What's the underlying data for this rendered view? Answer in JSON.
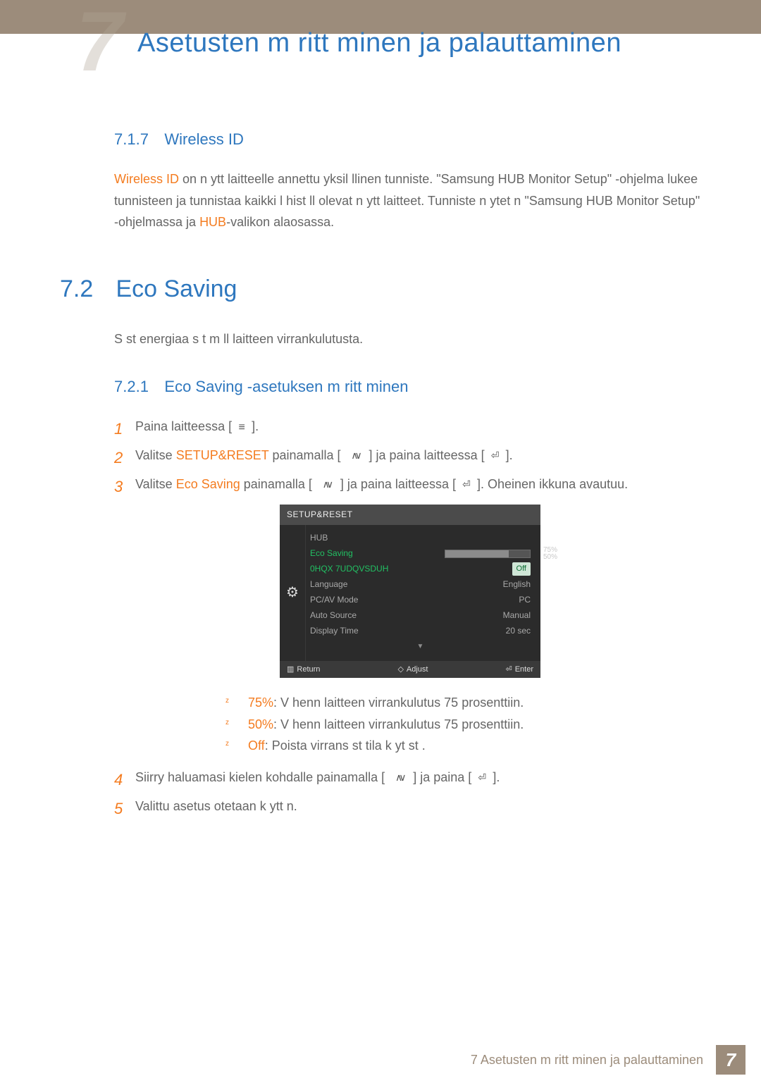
{
  "header": {
    "chapter_number_large": "7",
    "title": "Asetusten m  ritt minen ja palauttaminen"
  },
  "section_717": {
    "num": "7.1.7",
    "title": "Wireless ID",
    "lead_orange": "Wireless ID",
    "body_1": " on n ytt laitteelle annettu yksil llinen tunniste. \"Samsung HUB Monitor Setup\" -ohjelma lukee tunnisteen ja tunnistaa kaikki l hist ll  olevat n ytt laitteet. Tunniste n ytet  n \"Samsung HUB Monitor Setup\" -ohjelmassa ja ",
    "hub_orange": "HUB",
    "body_2": "-valikon alaosassa."
  },
  "section_72": {
    "num": "7.2",
    "title": "Eco Saving",
    "intro": "S  st  energiaa s  t m ll  laitteen virrankulutusta.",
    "sub_num": "7.2.1",
    "sub_title": "Eco Saving -asetuksen m  ritt minen",
    "steps": {
      "s1_a": "Paina laitteessa [",
      "s1_menu_icon": "≡",
      "s1_b": "  ].",
      "s2_a": "Valitse ",
      "s2_orange": "SETUP&RESET",
      "s2_b": " painamalla [",
      "s2_updown": "∧∨",
      "s2_c": "] ja paina laitteessa [",
      "s2_enter": "⏎",
      "s2_d": "].",
      "s3_a": "Valitse ",
      "s3_orange": "Eco Saving",
      "s3_b": " painamalla [",
      "s3_updown": "∧∨",
      "s3_c": "] ja paina laitteessa [",
      "s3_enter": "⏎",
      "s3_d": "]. Oheinen ikkuna avautuu.",
      "s4_a": "Siirry haluamasi kielen kohdalle painamalla [",
      "s4_updown": "∧∨",
      "s4_b": "  ] ja paina [",
      "s4_enter": "⏎",
      "s4_c": "  ].",
      "s5": "Valittu asetus otetaan k ytt  n."
    },
    "bullets": {
      "b1_label": "75%",
      "b1_text": ": V henn  laitteen virrankulutus 75 prosenttiin.",
      "b2_label": "50%",
      "b2_text": ": V henn  laitteen virrankulutus 75 prosenttiin.",
      "b3_label": "Off",
      "b3_text": ": Poista virrans  st tila k yt st ."
    }
  },
  "osd": {
    "header": "SETUP&RESET",
    "rows": {
      "hub_l": "HUB",
      "eco_l": "Eco Saving",
      "eco_r_75": "75%",
      "eco_r_50": "50%",
      "menutrans_l": "0HQX 7UDQVSDUH",
      "menutrans_r": "Off",
      "language_l": "Language",
      "language_r": "English",
      "pcav_l": "PC/AV Mode",
      "pcav_r": "PC",
      "autosrc_l": "Auto Source",
      "autosrc_r": "Manual",
      "disptime_l": "Display Time",
      "disptime_r": "20 sec"
    },
    "arrow_down": "▼",
    "footer": {
      "return_icon": "▥",
      "return": "Return",
      "adjust_icon": "◇",
      "adjust": "Adjust",
      "enter_icon": "⏎",
      "enter": "Enter"
    }
  },
  "footer": {
    "text": "7 Asetusten m  ritt minen ja palauttaminen",
    "page_badge": "7"
  }
}
